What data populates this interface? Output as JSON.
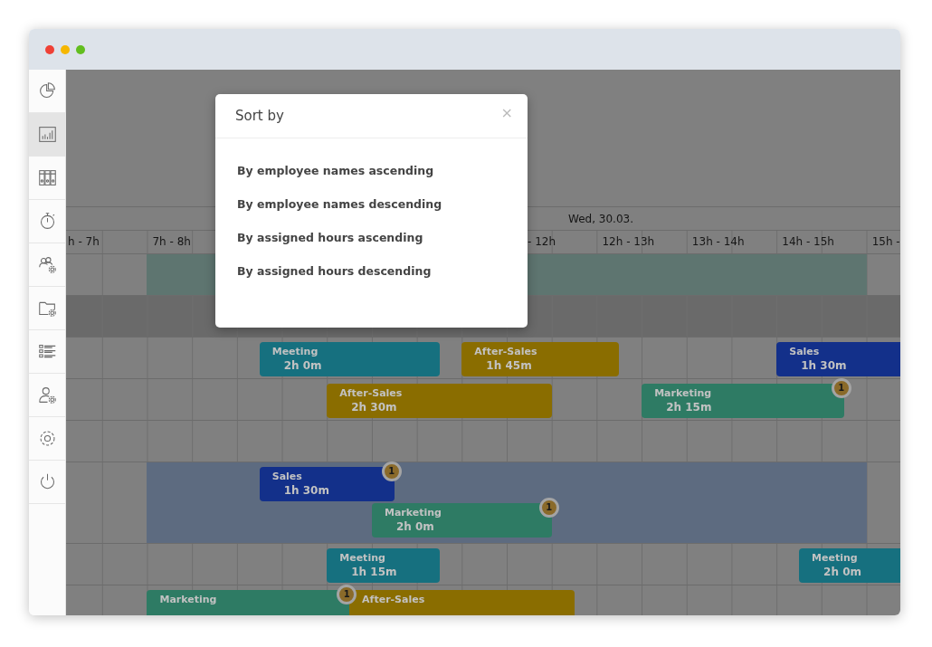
{
  "sidebar": {
    "items": [
      {
        "selected": false
      },
      {
        "selected": true
      },
      {
        "selected": false
      },
      {
        "selected": false
      },
      {
        "selected": false
      },
      {
        "selected": false
      },
      {
        "selected": false
      },
      {
        "selected": false
      },
      {
        "selected": false
      },
      {
        "selected": false
      }
    ]
  },
  "schedule": {
    "date": "Wed, 30.03.",
    "hours": [
      "h - 7h",
      "7h - 8h",
      "- 12h",
      "12h - 13h",
      "13h - 14h",
      "14h - 15h",
      "15h -"
    ],
    "rows": [
      {
        "kind": "single",
        "shaded": false,
        "band": {
          "color": "#5e7570"
        },
        "bars": []
      },
      {
        "kind": "single",
        "shaded": true,
        "bars": []
      },
      {
        "kind": "single",
        "shaded": false,
        "bars": [
          {
            "name": "Meeting",
            "duration": "2h 0m",
            "color": "#16707f"
          },
          {
            "name": "After-Sales",
            "duration": "1h 45m",
            "color": "#8a6d00"
          },
          {
            "name": "Sales",
            "duration": "1h 30m",
            "color": "#13308a"
          }
        ]
      },
      {
        "kind": "single",
        "shaded": false,
        "bars": [
          {
            "name": "After-Sales",
            "duration": "2h 30m",
            "color": "#8a6d00"
          },
          {
            "name": "Marketing",
            "duration": "2h 15m",
            "color": "#2e7b64",
            "badge": "1"
          }
        ]
      },
      {
        "kind": "single",
        "shaded": false,
        "bars": []
      },
      {
        "kind": "double",
        "shaded": false,
        "band": {
          "color": "#5d6b80"
        },
        "bars": [
          {
            "name": "Sales",
            "duration": "1h 30m",
            "color": "#13308a",
            "badge": "1"
          },
          {
            "name": "Marketing",
            "duration": "2h 0m",
            "color": "#2e7b64",
            "badge": "1"
          }
        ]
      },
      {
        "kind": "single",
        "shaded": false,
        "bars": [
          {
            "name": "Meeting",
            "duration": "1h 15m",
            "color": "#16707f"
          },
          {
            "name": "Meeting",
            "duration": "2h 0m",
            "color": "#16707f"
          }
        ]
      },
      {
        "kind": "single",
        "shaded": false,
        "bars": [
          {
            "name": "Marketing",
            "color": "#2e7b64",
            "badge": "1"
          },
          {
            "name": "After-Sales",
            "color": "#8a6d00"
          }
        ]
      }
    ]
  },
  "dialog": {
    "title": "Sort by",
    "close": "×",
    "options": [
      "By employee names ascending",
      "By employee names descending",
      "By assigned hours ascending",
      "By assigned hours descending"
    ]
  }
}
